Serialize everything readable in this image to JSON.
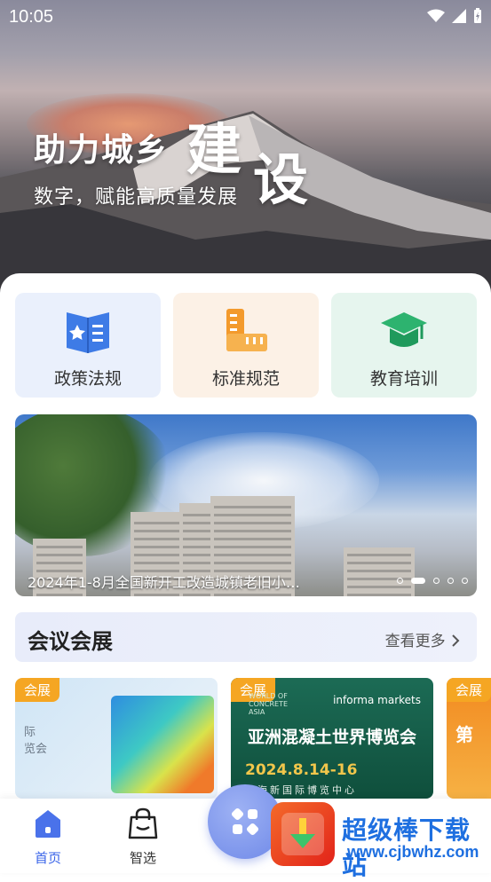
{
  "status_bar": {
    "time": "10:05"
  },
  "hero": {
    "headline": "助力城乡",
    "headline_big_1": "建",
    "headline_big_2": "设",
    "subline": "数字，赋能高质量发展"
  },
  "categories": [
    {
      "label": "政策法规",
      "icon": "policy-book-icon",
      "bg": "#eaf0fc"
    },
    {
      "label": "标准规范",
      "icon": "ruler-icon",
      "bg": "#fcf1e6"
    },
    {
      "label": "教育培训",
      "icon": "graduation-cap-icon",
      "bg": "#e6f5ee"
    }
  ],
  "banner": {
    "caption": "2024年1-8月全国新开工改造城镇老旧小…",
    "slide_count": 5,
    "active_slide": 2
  },
  "section": {
    "title": "会议会展",
    "more": "查看更多"
  },
  "cards": [
    {
      "tag": "会展",
      "text": "际\n览会"
    },
    {
      "tag": "会展",
      "brand": "informa markets",
      "brand2": "WORLD OF\nCONCRETE\nASIA",
      "title": "亚洲混凝土世界博览会",
      "date": "2024.8.14-16",
      "venue": "上海新国际博览中心"
    },
    {
      "tag": "会展",
      "text": "第"
    }
  ],
  "tabbar": {
    "items": [
      {
        "label": "首页",
        "icon": "home-icon",
        "active": true
      },
      {
        "label": "智选",
        "icon": "shopping-bag-icon",
        "active": false
      }
    ]
  },
  "watermark": {
    "title": "超级棒下载站",
    "url": "www.cjbwhz.com"
  },
  "colors": {
    "accent": "#3a64e8",
    "tag": "#f5a623"
  }
}
